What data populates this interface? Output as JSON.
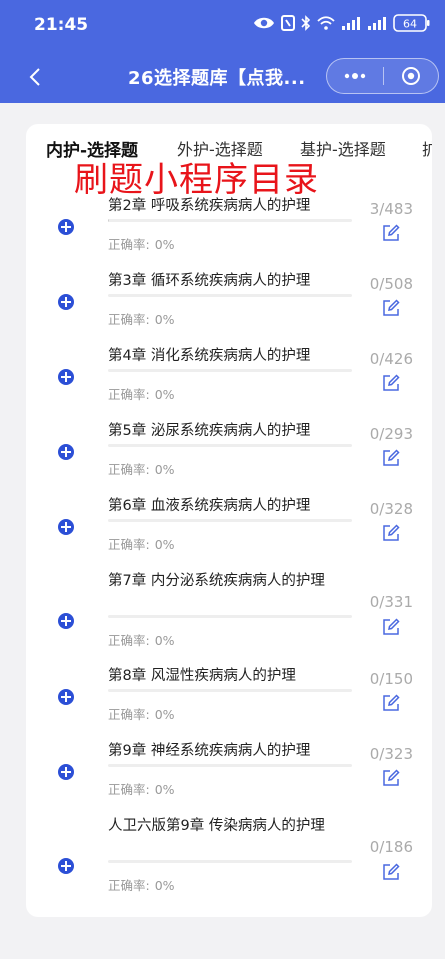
{
  "status_bar": {
    "time": "21:45",
    "battery": "64"
  },
  "nav": {
    "title": "26选择题库【点我..."
  },
  "tabs": [
    {
      "label": "内护-选择题",
      "active": true
    },
    {
      "label": "外护-选择题",
      "active": false
    },
    {
      "label": "基护-选择题",
      "active": false
    },
    {
      "label": "扩",
      "active": false
    }
  ],
  "overlay_text": "刷题小程序目录",
  "rate_label": "正确率:",
  "chapters": [
    {
      "title": "第2章 呼吸系统疾病病人的护理",
      "rate": "0%",
      "count": "3/483",
      "progress": 0.006
    },
    {
      "title": "第3章 循环系统疾病病人的护理",
      "rate": "0%",
      "count": "0/508",
      "progress": 0
    },
    {
      "title": "第4章 消化系统疾病病人的护理",
      "rate": "0%",
      "count": "0/426",
      "progress": 0
    },
    {
      "title": "第5章 泌尿系统疾病病人的护理",
      "rate": "0%",
      "count": "0/293",
      "progress": 0
    },
    {
      "title": "第6章 血液系统疾病病人的护理",
      "rate": "0%",
      "count": "0/328",
      "progress": 0
    },
    {
      "title": "第7章 内分泌系统疾病病人的护理",
      "rate": "0%",
      "count": "0/331",
      "progress": 0
    },
    {
      "title": "第8章 风湿性疾病病人的护理",
      "rate": "0%",
      "count": "0/150",
      "progress": 0
    },
    {
      "title": "第9章 神经系统疾病病人的护理",
      "rate": "0%",
      "count": "0/323",
      "progress": 0
    },
    {
      "title": "人卫六版第9章 传染病病人的护理",
      "rate": "0%",
      "count": "0/186",
      "progress": 0
    }
  ],
  "colors": {
    "header": "#4a68e0",
    "accent": "#2c4fd6",
    "overlay": "#e8141a"
  },
  "icons": [
    "eye-icon",
    "nfc-icon",
    "bluetooth-icon",
    "wifi-icon",
    "signal-icon",
    "battery-icon",
    "back-icon",
    "more-icon",
    "close-icon",
    "plus-icon",
    "edit-icon"
  ]
}
